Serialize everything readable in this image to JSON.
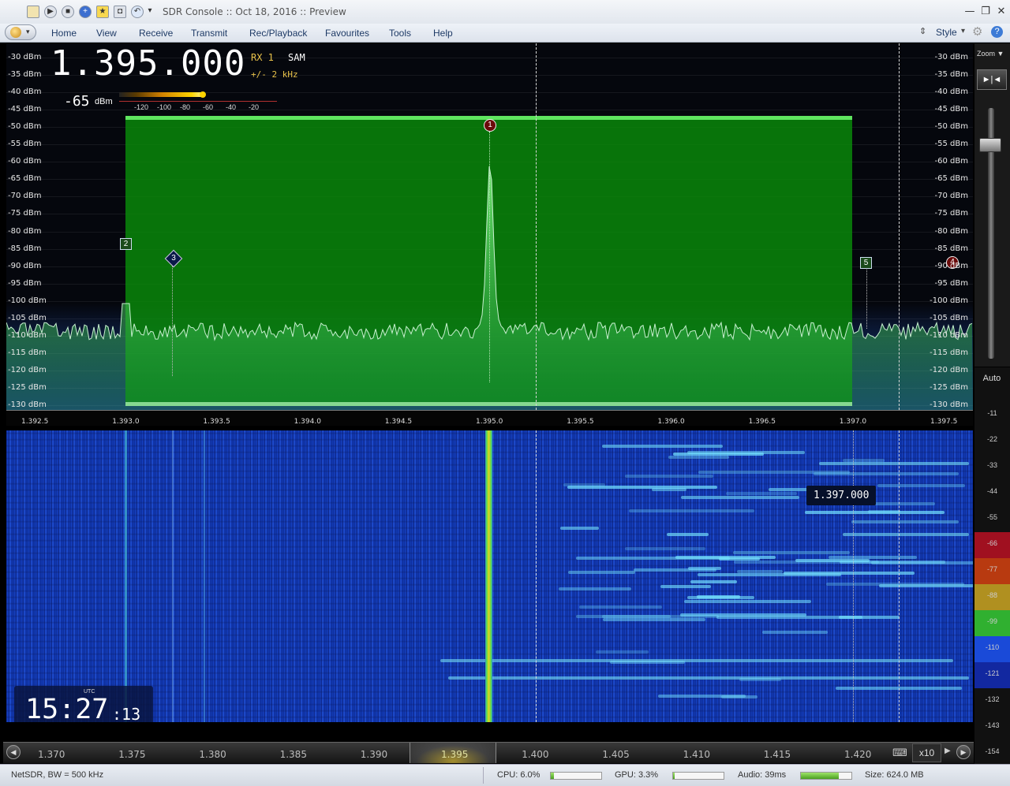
{
  "window": {
    "title": "SDR Console :: Oct 18, 2016 :: Preview",
    "minimize": "—",
    "restore": "❐",
    "close": "✕"
  },
  "menu": {
    "items": [
      "Home",
      "View",
      "Receive",
      "Transmit",
      "Rec/Playback",
      "Favourites",
      "Tools",
      "Help"
    ],
    "style_label": "Style"
  },
  "display": {
    "frequency": "1.395.000",
    "rx": "RX 1",
    "mode": "SAM",
    "bandwidth": "+/- 2 kHz",
    "signal_value": "-65",
    "signal_unit": "dBm",
    "smeter_scale": [
      "-120",
      "-100",
      "-80",
      "-60",
      "-40",
      "-20"
    ]
  },
  "spectrum": {
    "db_labels": [
      "-30 dBm",
      "-35 dBm",
      "-40 dBm",
      "-45 dBm",
      "-50 dBm",
      "-55 dBm",
      "-60 dBm",
      "-65 dBm",
      "-70 dBm",
      "-75 dBm",
      "-80 dBm",
      "-85 dBm",
      "-90 dBm",
      "-95 dBm",
      "-100 dBm",
      "-105 dBm",
      "-110 dBm",
      "-115 dBm",
      "-120 dBm",
      "-125 dBm",
      "-130 dBm"
    ],
    "freq_axis": [
      "1.392.5",
      "1.393.0",
      "1.393.5",
      "1.394.0",
      "1.394.5",
      "1.395.0",
      "1.395.5",
      "1.396.0",
      "1.396.5",
      "1.397.0",
      "1.397.5"
    ],
    "markers": [
      "1",
      "2",
      "3",
      "4",
      "5"
    ]
  },
  "waterfall": {
    "tooltip": "1.397.000",
    "clock_label": "UTC",
    "clock_hm": "15:27",
    "clock_s": ":13"
  },
  "zoom": {
    "label": "Zoom ▼",
    "auto_label": "Auto",
    "wf_scale": [
      "-11",
      "-22",
      "-33",
      "-44",
      "-55",
      "-66",
      "-77",
      "-88",
      "-99",
      "-110",
      "-121",
      "-132",
      "-143",
      "-154"
    ],
    "wf_colors": [
      "#111",
      "#111",
      "#111",
      "#111",
      "#111",
      "#a01020",
      "#b83a10",
      "#b09020",
      "#30b030",
      "#1a4ad8",
      "#1228a0",
      "#111",
      "#111",
      "#111"
    ]
  },
  "bottom_axis": {
    "labels": [
      "1.370",
      "1.375",
      "1.380",
      "1.385",
      "1.390",
      "1.395",
      "1.400",
      "1.405",
      "1.410",
      "1.415",
      "1.420"
    ],
    "multiplier": "x10"
  },
  "status": {
    "device": "NetSDR, BW = 500 kHz",
    "cpu": "CPU: 6.0%",
    "cpu_level": 0.06,
    "gpu": "GPU: 3.3%",
    "gpu_level": 0.033,
    "audio": "Audio: 39ms",
    "audio_level": 0.75,
    "size": "Size: 624.0 MB"
  }
}
